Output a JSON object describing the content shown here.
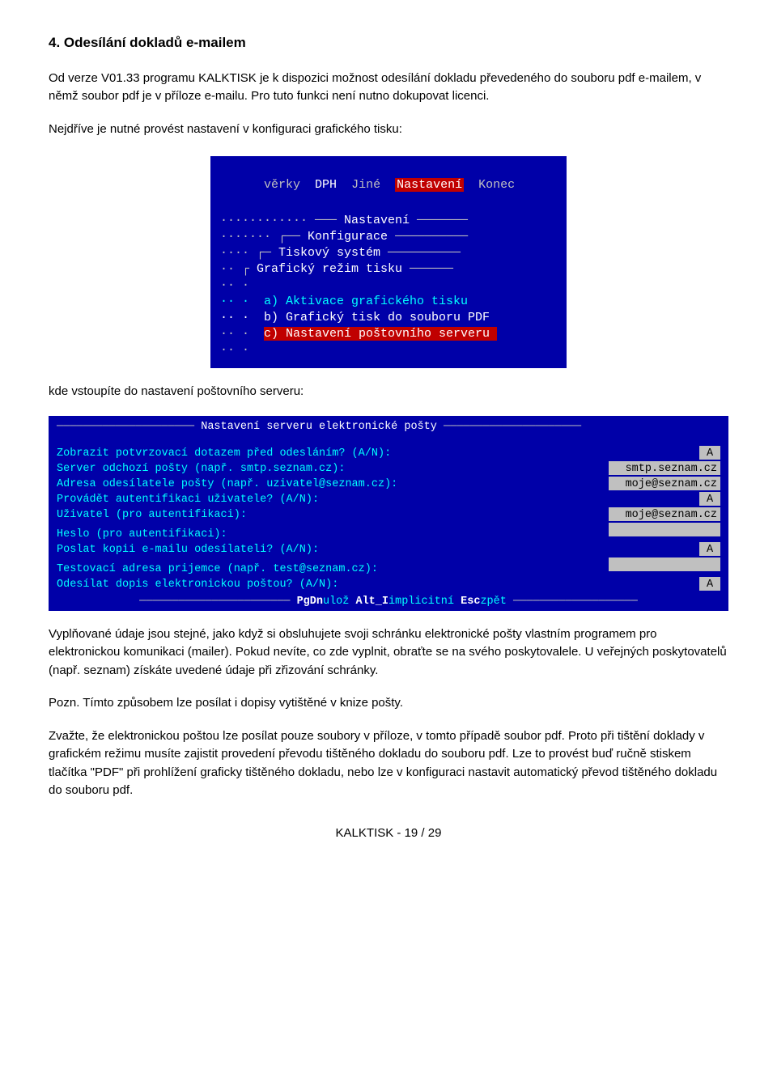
{
  "heading": "4. Odesílání dokladů e-mailem",
  "para1": "Od verze V01.33 programu KALKTISK je k dispozici možnost odesílání dokladu převedeného do souboru pdf e-mailem, v němž soubor pdf je v příloze e-mailu. Pro tuto funkci není nutno dokupovat licenci.",
  "para2": "Nejdříve je nutné provést nastavení v konfiguraci grafického tisku:",
  "shot1": {
    "menubar": {
      "m1": "věrky",
      "m2": "DPH",
      "m3": "Jiné",
      "m4": "Nastavení",
      "m5": "Konec"
    },
    "rows": {
      "dots1": "············ ─── ",
      "t1": "Nastavení",
      "t1end": " ───────",
      "dots2": "······· ┌── ",
      "t2": "Konfigurace",
      "t2end": " ──────────",
      "dots3": "···· ┌─ ",
      "t3": "Tiskový systém",
      "t3end": " ──────────",
      "dots4": "·· ┌ ",
      "t4": "Grafický režim tisku",
      "t4end": " ──────",
      "blank": "·· ·",
      "optA": "·· ·  a) Aktivace grafického tisku ",
      "optB": "·· ·  b) Grafický tisk do souboru PDF",
      "optC_pre": "·· ·  ",
      "optC": "c) Nastavení poštovního serveru ",
      "tail": "·· ·"
    }
  },
  "para3": "kde vstoupíte do nastavení poštovního serveru:",
  "shot2": {
    "title_pre": "───────────────────── ",
    "title": "Nastavení serveru elektronické pošty",
    "title_post": " ─────────────────────",
    "rows": [
      {
        "label": "Zobrazit potvrzovací dotazem před odesláním? (A/N):",
        "value": "A",
        "narrow": true
      },
      {
        "label": "Server odchozí pošty (např. smtp.seznam.cz):",
        "value": "smtp.seznam.cz",
        "narrow": false
      },
      {
        "label": "Adresa odesílatele pošty (např. uzivatel@seznam.cz):",
        "value": "moje@seznam.cz",
        "narrow": false
      },
      {
        "label": "Provádět autentifikaci uživatele? (A/N):",
        "value": "A",
        "narrow": true
      },
      {
        "label": "Uživatel (pro autentifikaci):",
        "value": "moje@seznam.cz",
        "narrow": false
      },
      {
        "label": "Heslo (pro autentifikaci):",
        "value": "",
        "narrow": false
      },
      {
        "label": "Poslat kopii e-mailu odesílateli? (A/N):",
        "value": "A",
        "narrow": true
      },
      {
        "label": "Testovací adresa prijemce (např. test@seznam.cz):",
        "value": "",
        "narrow": false
      },
      {
        "label": "Odesílat dopis elektronickou poštou? (A/N):",
        "value": "A",
        "narrow": true
      }
    ],
    "footer_pre": "─────────────────────── ",
    "footer_bold1": "PgDn",
    "footer_l1": "ulož ",
    "footer_bold2": "Alt_I",
    "footer_l2": "implicitní ",
    "footer_bold3": "Esc",
    "footer_l3": "zpět",
    "footer_post": " ───────────────────"
  },
  "para4": "Vyplňované údaje jsou stejné, jako když si obsluhujete svoji schránku elektronické pošty vlastním programem pro elektronickou komunikaci (mailer). Pokud nevíte, co zde vyplnit, obraťte se na svého poskytovalele. U veřejných poskytovatelů (např. seznam) získáte uvedené údaje při zřizování schránky.",
  "para5": "Pozn. Tímto způsobem lze posílat i dopisy vytištěné v knize pošty.",
  "para6": "Zvažte, že elektronickou poštou lze posílat pouze soubory v příloze, v tomto případě soubor pdf. Proto při tištění doklady v grafickém režimu musíte zajistit provedení převodu tištěného dokladu do souboru pdf. Lze to provést buď ručně stiskem tlačítka \"PDF\" při prohlížení graficky tištěného dokladu, nebo lze v konfiguraci nastavit automatický převod tištěného dokladu do souboru pdf.",
  "pagenum": "KALKTISK - 19 / 29"
}
